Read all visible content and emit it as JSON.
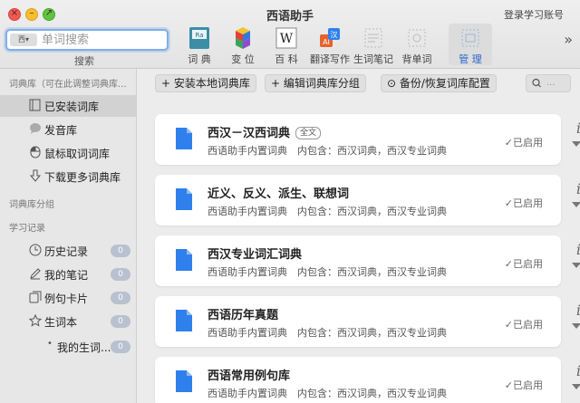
{
  "app": {
    "title": "西语助手",
    "account_label": "登录学习账号"
  },
  "search": {
    "mode_label": "西▾",
    "placeholder": "单词搜索",
    "caption": "搜索"
  },
  "tools": [
    {
      "label": "词 典",
      "icon": "dictionary-book-icon"
    },
    {
      "label": "变 位",
      "icon": "conjugation-cubes-icon"
    },
    {
      "label": "百 科",
      "icon": "wikipedia-icon"
    },
    {
      "label": "翻译写作",
      "icon": "translate-icon"
    },
    {
      "label": "生词笔记",
      "icon": "vocab-notes-icon"
    },
    {
      "label": "背单词",
      "icon": "flashcards-icon"
    },
    {
      "label": "管 理",
      "icon": "manage-icon",
      "active": true
    }
  ],
  "sidebar": {
    "dict_section": "词典库（可在此调整词典库...",
    "dict_items": [
      {
        "label": "已安装词库",
        "icon": "book-icon",
        "selected": true
      },
      {
        "label": "发音库",
        "icon": "speech-bubble-icon"
      },
      {
        "label": "鼠标取词词库",
        "icon": "mouse-icon"
      },
      {
        "label": "下载更多词典库",
        "icon": "download-icon"
      }
    ],
    "group_section": "词典库分组",
    "study_section": "学习记录",
    "study_items": [
      {
        "label": "历史记录",
        "icon": "clock-icon",
        "badge": "0"
      },
      {
        "label": "我的笔记",
        "icon": "pencil-icon",
        "badge": "0"
      },
      {
        "label": "例句卡片",
        "icon": "cards-icon",
        "badge": "0"
      },
      {
        "label": "生词本",
        "icon": "star-icon",
        "badge": "0"
      },
      {
        "label": "我的生词...",
        "icon": "bullet-icon",
        "badge": "0"
      }
    ]
  },
  "actions": {
    "install": "+ 安装本地词典库",
    "edit_group": "+ 编辑词典库分组",
    "backup": "备份/恢复词库配置",
    "search_placeholder": "..."
  },
  "dictionaries": [
    {
      "title": "西汉－汉西词典",
      "tag": "全文",
      "desc": "西语助手内置词典　内包含：西汉词典，西汉专业词典",
      "status": "已启用"
    },
    {
      "title": "近义、反义、派生、联想词",
      "tag": "",
      "desc": "西语助手内置词典　内包含：西汉词典，西汉专业词典",
      "status": "已启用"
    },
    {
      "title": "西汉专业词汇词典",
      "tag": "",
      "desc": "西语助手内置词典　内包含：西汉词典，西汉专业词典",
      "status": "已启用"
    },
    {
      "title": "西语历年真题",
      "tag": "",
      "desc": "西语助手内置词典　内包含：西汉词典，西汉专业词典",
      "status": "已启用"
    },
    {
      "title": "西语常用例句库",
      "tag": "",
      "desc": "西语助手内置词典　内包含：西汉词典，西汉专业词典",
      "status": "已启用"
    }
  ],
  "colors": {
    "accent": "#2a66c9",
    "doc_icon": "#2f80ed",
    "focus_ring": "#7faee8"
  }
}
